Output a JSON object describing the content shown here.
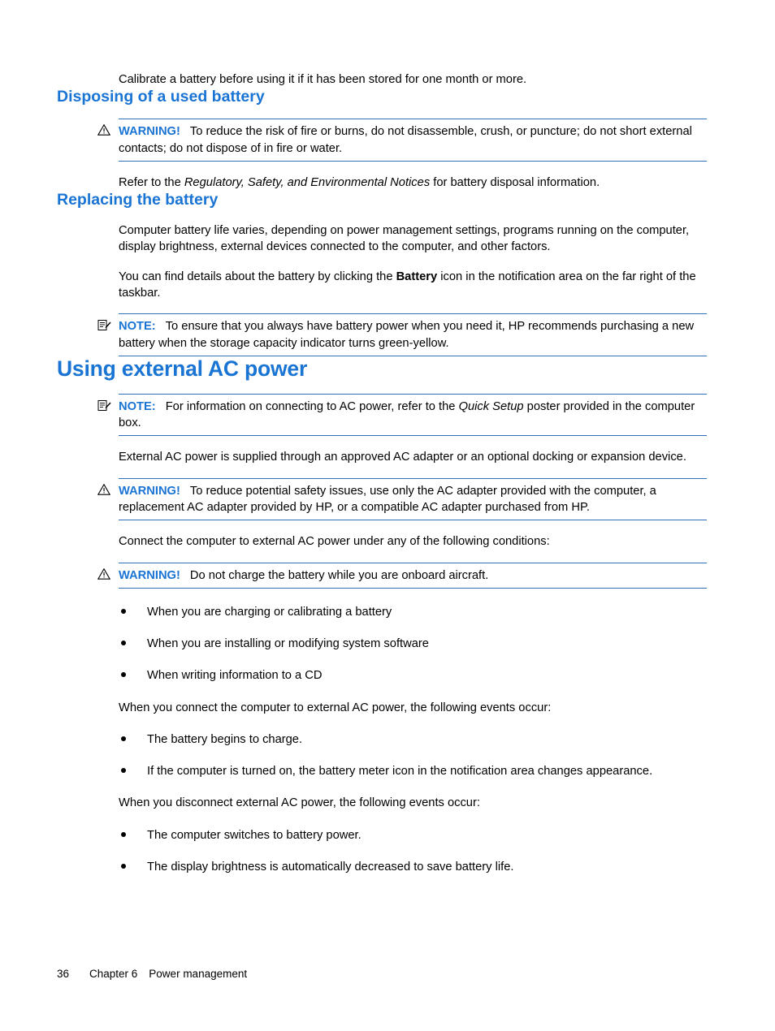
{
  "document": {
    "intro_paragraph": "Calibrate a battery before using it if it has been stored for one month or more.",
    "sections": [
      {
        "heading": "Disposing of a used battery",
        "warning_label": "WARNING!",
        "warning_text": "To reduce the risk of fire or burns, do not disassemble, crush, or puncture; do not short external contacts; do not dispose of in fire or water.",
        "refer_prefix": "Refer to the ",
        "refer_italic": "Regulatory, Safety, and Environmental Notices",
        "refer_suffix": " for battery disposal information."
      },
      {
        "heading": "Replacing the battery",
        "para1": "Computer battery life varies, depending on power management settings, programs running on the computer, display brightness, external devices connected to the computer, and other factors.",
        "para2_prefix": "You can find details about the battery by clicking the ",
        "para2_bold": "Battery",
        "para2_suffix": " icon in the notification area on the far right of the taskbar.",
        "note_label": "NOTE:",
        "note_text": "To ensure that you always have battery power when you need it, HP recommends purchasing a new battery when the storage capacity indicator turns green-yellow."
      }
    ],
    "main_heading": "Using external AC power",
    "ac_note_label": "NOTE:",
    "ac_note_prefix": "For information on connecting to AC power, refer to the ",
    "ac_note_italic": "Quick Setup",
    "ac_note_suffix": " poster provided in the computer box.",
    "ac_para1": "External AC power is supplied through an approved AC adapter or an optional docking or expansion device.",
    "ac_warning1_label": "WARNING!",
    "ac_warning1_text": "To reduce potential safety issues, use only the AC adapter provided with the computer, a replacement AC adapter provided by HP, or a compatible AC adapter purchased from HP.",
    "ac_para2": "Connect the computer to external AC power under any of the following conditions:",
    "ac_warning2_label": "WARNING!",
    "ac_warning2_text": "Do not charge the battery while you are onboard aircraft.",
    "conditions_list": [
      "When you are charging or calibrating a battery",
      "When you are installing or modifying system software",
      "When writing information to a CD"
    ],
    "connect_intro": "When you connect the computer to external AC power, the following events occur:",
    "connect_list": [
      "The battery begins to charge.",
      "If the computer is turned on, the battery meter icon in the notification area changes appearance."
    ],
    "disconnect_intro": "When you disconnect external AC power, the following events occur:",
    "disconnect_list": [
      "The computer switches to battery power.",
      "The display brightness is automatically decreased to save battery life."
    ]
  },
  "footer": {
    "page_number": "36",
    "chapter_label": "Chapter 6",
    "chapter_title": "Power management"
  },
  "colors": {
    "heading_blue": "#1a74d4",
    "rule_blue": "#2f6fba",
    "text_black": "#000000"
  },
  "icons": {
    "warning": "warning-triangle-icon",
    "note": "note-pencil-icon"
  }
}
